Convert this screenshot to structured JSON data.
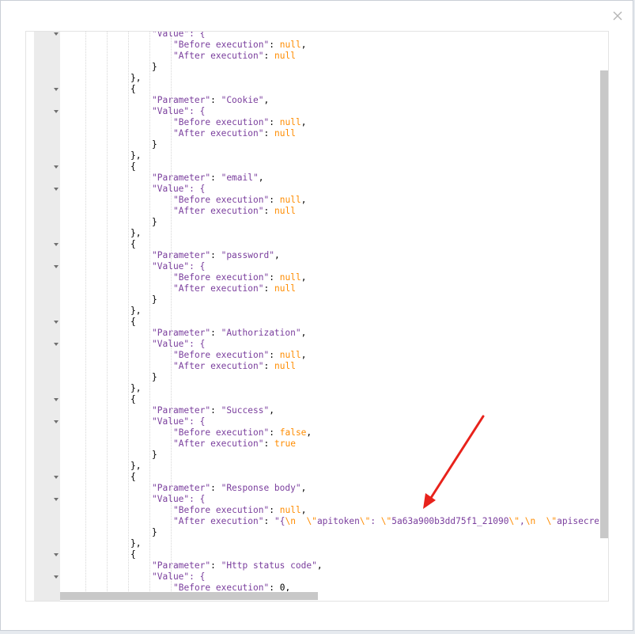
{
  "dialog": {
    "close_icon": "close-icon"
  },
  "annotation": {
    "color": "#e8221b",
    "type": "red-arrow"
  },
  "editor": {
    "lines": [
      [
        [
          "",
          "\"Value\": {",
          "key"
        ]
      ],
      [
        [
          "    ",
          "\"Before execution\"",
          "key"
        ],
        [
          ": ",
          "",
          "punct"
        ],
        [
          "null",
          "",
          "kw"
        ],
        [
          ",",
          "",
          "punct"
        ]
      ],
      [
        [
          "    ",
          "\"After execution\"",
          "key"
        ],
        [
          ": ",
          "",
          "punct"
        ],
        [
          "null",
          "",
          "kw"
        ]
      ],
      [
        [
          "",
          "}",
          "punct"
        ]
      ],
      [
        [
          "-2",
          "},",
          "punct"
        ]
      ],
      [
        [
          "-2",
          "{",
          "punct"
        ]
      ],
      [
        [
          "",
          "\"Parameter\"",
          "key"
        ],
        [
          ": ",
          "",
          "punct"
        ],
        [
          "\"Cookie\"",
          "",
          "str"
        ],
        [
          ",",
          "",
          "punct"
        ]
      ],
      [
        [
          "",
          "\"Value\": {",
          "key"
        ]
      ],
      [
        [
          "    ",
          "\"Before execution\"",
          "key"
        ],
        [
          ": ",
          "",
          "punct"
        ],
        [
          "null",
          "",
          "kw"
        ],
        [
          ",",
          "",
          "punct"
        ]
      ],
      [
        [
          "    ",
          "\"After execution\"",
          "key"
        ],
        [
          ": ",
          "",
          "punct"
        ],
        [
          "null",
          "",
          "kw"
        ]
      ],
      [
        [
          "",
          "}",
          "punct"
        ]
      ],
      [
        [
          "-2",
          "},",
          "punct"
        ]
      ],
      [
        [
          "-2",
          "{",
          "punct"
        ]
      ],
      [
        [
          "",
          "\"Parameter\"",
          "key"
        ],
        [
          ": ",
          "",
          "punct"
        ],
        [
          "\"email\"",
          "",
          "str"
        ],
        [
          ",",
          "",
          "punct"
        ]
      ],
      [
        [
          "",
          "\"Value\": {",
          "key"
        ]
      ],
      [
        [
          "    ",
          "\"Before execution\"",
          "key"
        ],
        [
          ": ",
          "",
          "punct"
        ],
        [
          "null",
          "",
          "kw"
        ],
        [
          ",",
          "",
          "punct"
        ]
      ],
      [
        [
          "    ",
          "\"After execution\"",
          "key"
        ],
        [
          ": ",
          "",
          "punct"
        ],
        [
          "null",
          "",
          "kw"
        ]
      ],
      [
        [
          "",
          "}",
          "punct"
        ]
      ],
      [
        [
          "-2",
          "},",
          "punct"
        ]
      ],
      [
        [
          "-2",
          "{",
          "punct"
        ]
      ],
      [
        [
          "",
          "\"Parameter\"",
          "key"
        ],
        [
          ": ",
          "",
          "punct"
        ],
        [
          "\"password\"",
          "",
          "str"
        ],
        [
          ",",
          "",
          "punct"
        ]
      ],
      [
        [
          "",
          "\"Value\": {",
          "key"
        ]
      ],
      [
        [
          "    ",
          "\"Before execution\"",
          "key"
        ],
        [
          ": ",
          "",
          "punct"
        ],
        [
          "null",
          "",
          "kw"
        ],
        [
          ",",
          "",
          "punct"
        ]
      ],
      [
        [
          "    ",
          "\"After execution\"",
          "key"
        ],
        [
          ": ",
          "",
          "punct"
        ],
        [
          "null",
          "",
          "kw"
        ]
      ],
      [
        [
          "",
          "}",
          "punct"
        ]
      ],
      [
        [
          "-2",
          "},",
          "punct"
        ]
      ],
      [
        [
          "-2",
          "{",
          "punct"
        ]
      ],
      [
        [
          "",
          "\"Parameter\"",
          "key"
        ],
        [
          ": ",
          "",
          "punct"
        ],
        [
          "\"Authorization\"",
          "",
          "str"
        ],
        [
          ",",
          "",
          "punct"
        ]
      ],
      [
        [
          "",
          "\"Value\": {",
          "key"
        ]
      ],
      [
        [
          "    ",
          "\"Before execution\"",
          "key"
        ],
        [
          ": ",
          "",
          "punct"
        ],
        [
          "null",
          "",
          "kw"
        ],
        [
          ",",
          "",
          "punct"
        ]
      ],
      [
        [
          "    ",
          "\"After execution\"",
          "key"
        ],
        [
          ": ",
          "",
          "punct"
        ],
        [
          "null",
          "",
          "kw"
        ]
      ],
      [
        [
          "",
          "}",
          "punct"
        ]
      ],
      [
        [
          "-2",
          "},",
          "punct"
        ]
      ],
      [
        [
          "-2",
          "{",
          "punct"
        ]
      ],
      [
        [
          "",
          "\"Parameter\"",
          "key"
        ],
        [
          ": ",
          "",
          "punct"
        ],
        [
          "\"Success\"",
          "",
          "str"
        ],
        [
          ",",
          "",
          "punct"
        ]
      ],
      [
        [
          "",
          "\"Value\": {",
          "key"
        ]
      ],
      [
        [
          "    ",
          "\"Before execution\"",
          "key"
        ],
        [
          ": ",
          "",
          "punct"
        ],
        [
          "false",
          "",
          "kw"
        ],
        [
          ",",
          "",
          "punct"
        ]
      ],
      [
        [
          "    ",
          "\"After execution\"",
          "key"
        ],
        [
          ": ",
          "",
          "punct"
        ],
        [
          "true",
          "",
          "kw"
        ]
      ],
      [
        [
          "",
          "}",
          "punct"
        ]
      ],
      [
        [
          "-2",
          "},",
          "punct"
        ]
      ],
      [
        [
          "-2",
          "{",
          "punct"
        ]
      ],
      [
        [
          "",
          "\"Parameter\"",
          "key"
        ],
        [
          ": ",
          "",
          "punct"
        ],
        [
          "\"Response body\"",
          "",
          "str"
        ],
        [
          ",",
          "",
          "punct"
        ]
      ],
      [
        [
          "",
          "\"Value\": {",
          "key"
        ]
      ],
      [
        [
          "    ",
          "\"Before execution\"",
          "key"
        ],
        [
          ": ",
          "",
          "punct"
        ],
        [
          "null",
          "",
          "kw"
        ],
        [
          ",",
          "",
          "punct"
        ]
      ],
      [
        [
          "    ",
          "\"After execution\"",
          "key"
        ],
        [
          ": ",
          "",
          "punct"
        ],
        [
          "\"{",
          "",
          "str"
        ],
        [
          "\\n",
          "",
          "esc"
        ],
        [
          "  ",
          "",
          "str"
        ],
        [
          "\\\"",
          "",
          "esc"
        ],
        [
          "apitoken",
          "",
          "str"
        ],
        [
          "\\\"",
          "",
          "esc"
        ],
        [
          ": ",
          "",
          "str"
        ],
        [
          "\\\"",
          "",
          "esc"
        ],
        [
          "5a63a900b3dd75f1_21090",
          "",
          "str"
        ],
        [
          "\\\"",
          "",
          "esc"
        ],
        [
          ",",
          "",
          "str"
        ],
        [
          "\\n",
          "",
          "esc"
        ],
        [
          "  ",
          "",
          "str"
        ],
        [
          "\\\"",
          "",
          "esc"
        ],
        [
          "apisecret",
          "",
          "str"
        ],
        [
          "\\\"",
          "",
          "esc"
        ],
        [
          ": ",
          "",
          "str"
        ],
        [
          "\\\"",
          "",
          "esc"
        ]
      ],
      [
        [
          "",
          "}",
          "punct"
        ]
      ],
      [
        [
          "-2",
          "},",
          "punct"
        ]
      ],
      [
        [
          "-2",
          "{",
          "punct"
        ]
      ],
      [
        [
          "",
          "\"Parameter\"",
          "key"
        ],
        [
          ": ",
          "",
          "punct"
        ],
        [
          "\"Http status code\"",
          "",
          "str"
        ],
        [
          ",",
          "",
          "punct"
        ]
      ],
      [
        [
          "",
          "\"Value\": {",
          "key"
        ]
      ],
      [
        [
          "    ",
          "\"Before execution\"",
          "key"
        ],
        [
          ": ",
          "",
          "punct"
        ],
        [
          "0",
          "",
          "num"
        ],
        [
          ",",
          "",
          "punct"
        ]
      ]
    ]
  }
}
